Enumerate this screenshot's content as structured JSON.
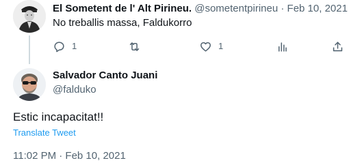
{
  "parent_tweet": {
    "display_name": "El Sometent de l' Alt Pirineu.",
    "handle": "@sometentpirineu",
    "separator": "·",
    "date": "Feb 10, 2021",
    "text": "No treballis massa, Faldukorro",
    "actions": {
      "reply_icon": "reply-icon",
      "reply_count": "1",
      "retweet_icon": "retweet-icon",
      "retweet_count": "",
      "like_icon": "heart-icon",
      "like_count": "1",
      "views_icon": "analytics-icon",
      "share_icon": "share-icon"
    }
  },
  "main_tweet": {
    "display_name": "Salvador Canto Juani",
    "handle": "@falduko",
    "text": "Estic incapacitat!!",
    "translate_label": "Translate Tweet",
    "timestamp": "11:02 PM · Feb 10, 2021"
  },
  "colors": {
    "primary_text": "#0f1419",
    "secondary_text": "#536471",
    "link": "#1d9bf0",
    "thread_line": "#cfd9de"
  }
}
